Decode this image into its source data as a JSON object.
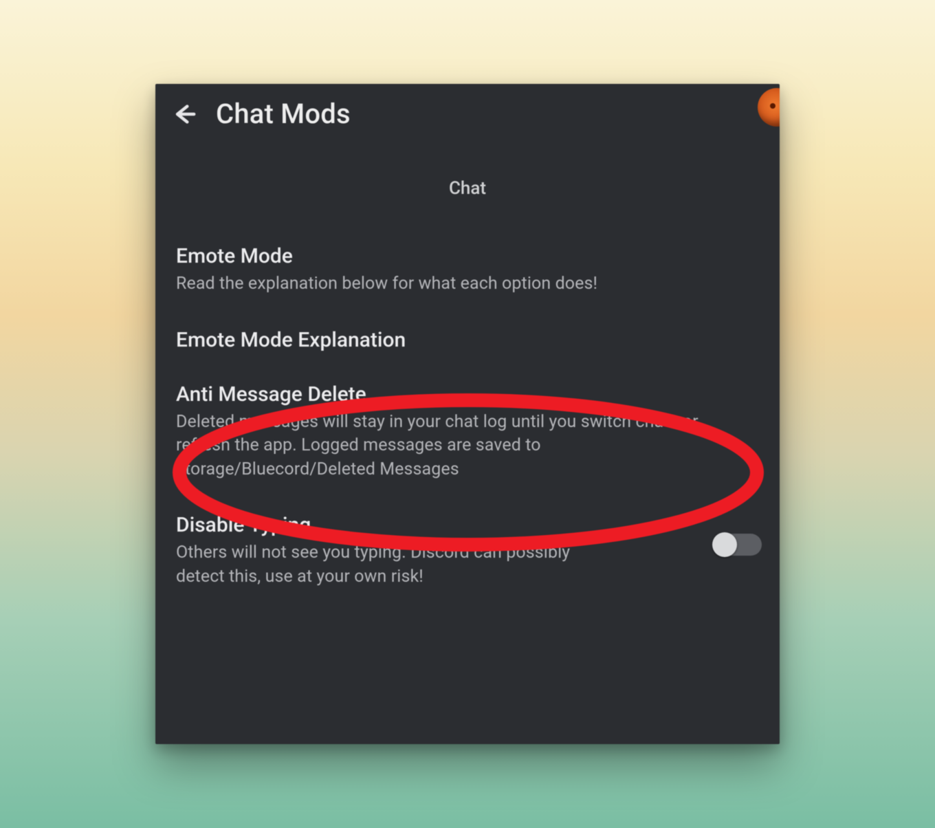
{
  "header": {
    "back_icon": "back-arrow",
    "title": "Chat Mods"
  },
  "section_heading": "Chat",
  "settings": {
    "emote_mode": {
      "title": "Emote Mode",
      "desc": "Read the explanation below for what each option does!"
    },
    "emote_mode_explanation": {
      "title": "Emote Mode Explanation"
    },
    "anti_message_delete": {
      "title": "Anti Message Delete",
      "desc": "Deleted messages will stay in your chat log until you switch chats or refresh the app. Logged messages are saved to storage/Bluecord/Deleted Messages"
    },
    "disable_typing": {
      "title": "Disable Typing",
      "desc": "Others will not see you typing. Discord can possibly detect this, use at your own risk!",
      "enabled": false
    }
  },
  "annotation": {
    "color": "#ed1c24",
    "target": "anti_message_delete"
  }
}
